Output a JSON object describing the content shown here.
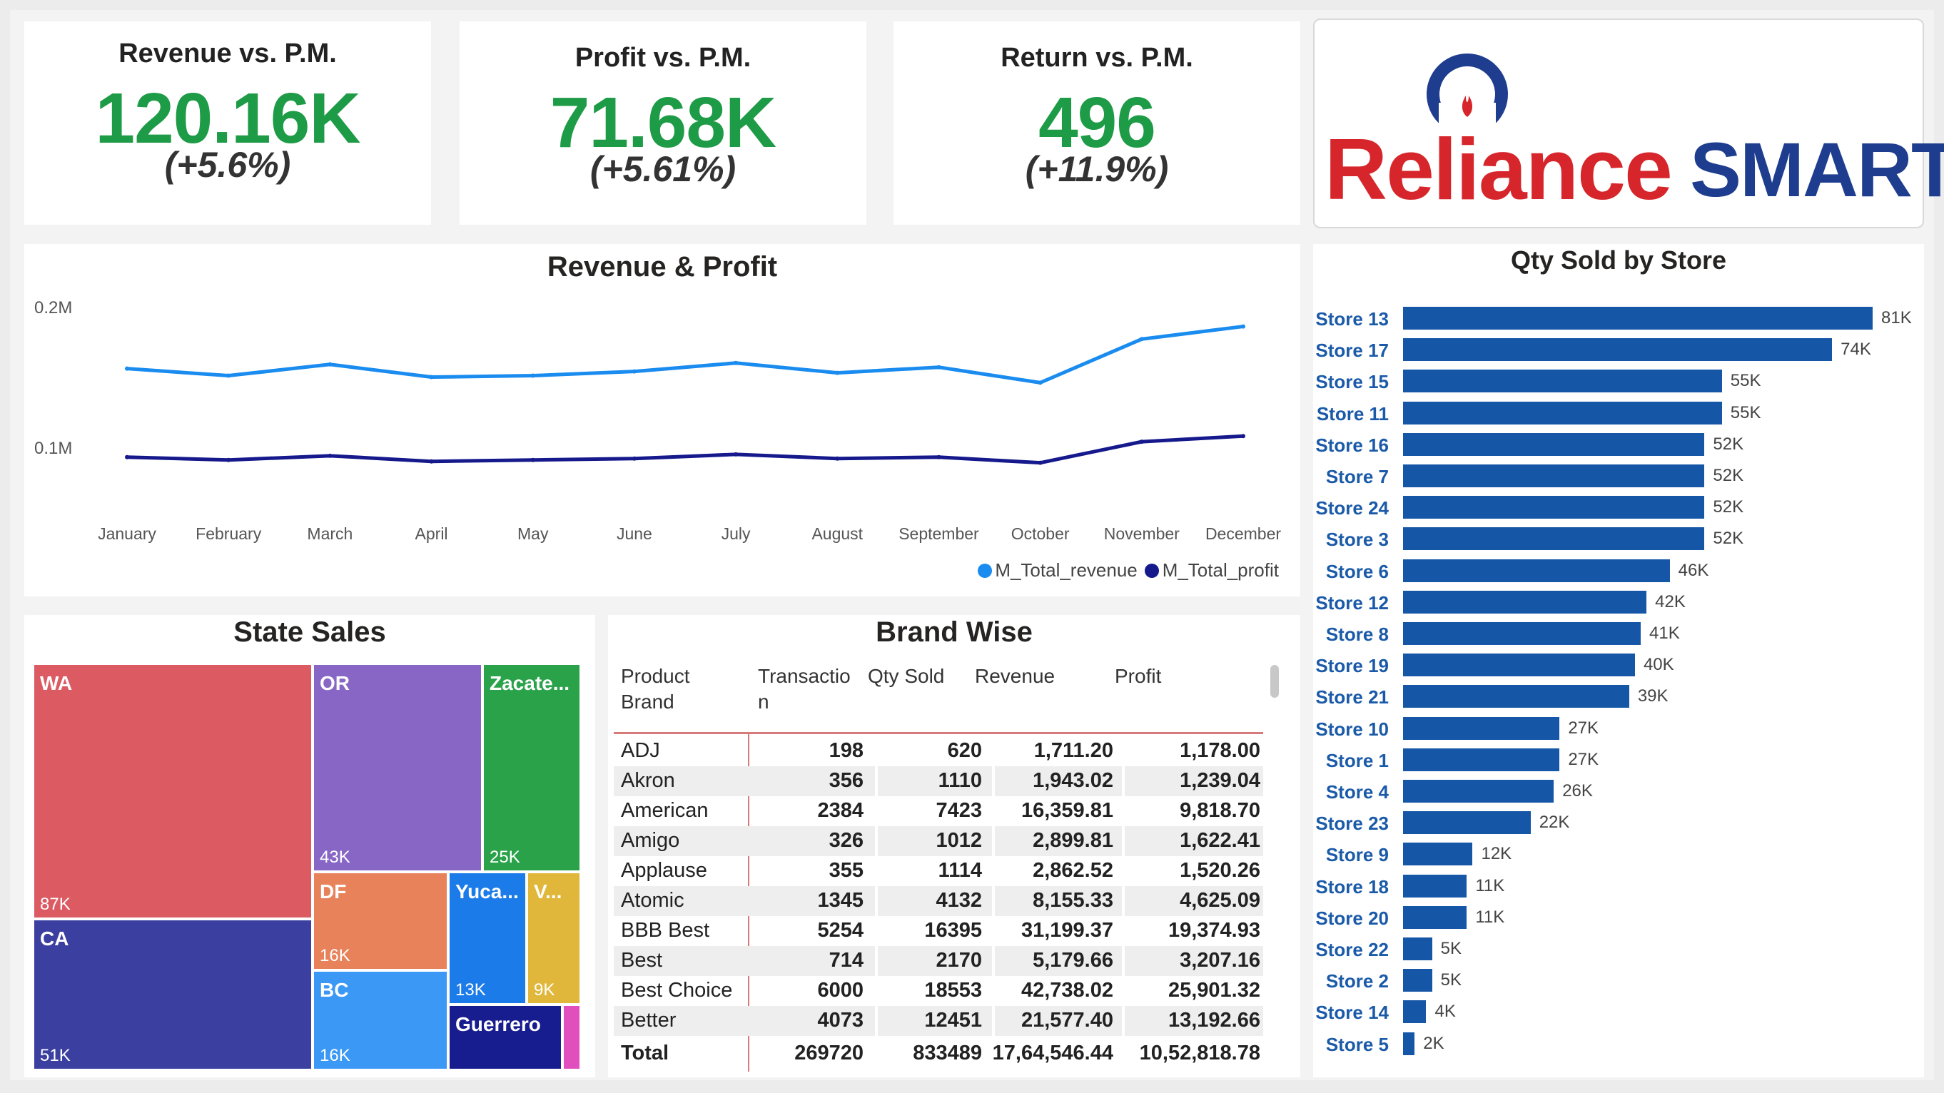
{
  "kpis": [
    {
      "title": "Revenue vs. P.M.",
      "value": "120.16K",
      "delta": "(+5.6%)"
    },
    {
      "title": "Profit vs. P.M.",
      "value": "71.68K",
      "delta": "(+5.61%)"
    },
    {
      "title": "Return vs. P.M.",
      "value": "496",
      "delta": "(+11.9%)"
    }
  ],
  "colors": {
    "kpi_green": "#1e9b46",
    "revenue_line": "#1a8cf0",
    "profit_line": "#15198c",
    "bar": "#1557a6",
    "store_label": "#1a5aa8"
  },
  "logo": {
    "word1": "Reliance",
    "word2": "SMART"
  },
  "revenue_profit": {
    "title": "Revenue & Profit",
    "legend": [
      "M_Total_revenue",
      "M_Total_profit"
    ],
    "y_ticks": [
      "0.2M",
      "0.1M"
    ]
  },
  "state_sales": {
    "title": "State Sales"
  },
  "brand_table": {
    "title": "Brand Wise",
    "headers": [
      "Product Brand",
      "Transaction",
      "Qty Sold",
      "Revenue",
      "Profit"
    ],
    "header_display": [
      [
        "Product",
        "Brand"
      ],
      [
        "Transactio",
        "n"
      ],
      [
        "Qty Sold"
      ],
      [
        "Revenue"
      ],
      [
        "Profit"
      ]
    ],
    "rows": [
      [
        "ADJ",
        "198",
        "620",
        "1,711.20",
        "1,178.00"
      ],
      [
        "Akron",
        "356",
        "1110",
        "1,943.02",
        "1,239.04"
      ],
      [
        "American",
        "2384",
        "7423",
        "16,359.81",
        "9,818.70"
      ],
      [
        "Amigo",
        "326",
        "1012",
        "2,899.81",
        "1,622.41"
      ],
      [
        "Applause",
        "355",
        "1114",
        "2,862.52",
        "1,520.26"
      ],
      [
        "Atomic",
        "1345",
        "4132",
        "8,155.33",
        "4,625.09"
      ],
      [
        "BBB Best",
        "5254",
        "16395",
        "31,199.37",
        "19,374.93"
      ],
      [
        "Best",
        "714",
        "2170",
        "5,179.66",
        "3,207.16"
      ],
      [
        "Best Choice",
        "6000",
        "18553",
        "42,738.02",
        "25,901.32"
      ],
      [
        "Better",
        "4073",
        "12451",
        "21,577.40",
        "13,192.66"
      ]
    ],
    "total": [
      "Total",
      "269720",
      "833489",
      "17,64,546.44",
      "10,52,818.78"
    ]
  },
  "qty_by_store": {
    "title": "Qty Sold by Store"
  },
  "chart_data": [
    {
      "type": "line",
      "title": "Revenue & Profit",
      "x": [
        "January",
        "February",
        "March",
        "April",
        "May",
        "June",
        "July",
        "August",
        "September",
        "October",
        "November",
        "December"
      ],
      "ylim": [
        0,
        0.2
      ],
      "y_unit": "M",
      "series": [
        {
          "name": "M_Total_revenue",
          "values": [
            0.156,
            0.151,
            0.159,
            0.15,
            0.151,
            0.154,
            0.16,
            0.153,
            0.157,
            0.146,
            0.177,
            0.186
          ]
        },
        {
          "name": "M_Total_profit",
          "values": [
            0.093,
            0.091,
            0.094,
            0.09,
            0.091,
            0.092,
            0.095,
            0.092,
            0.093,
            0.089,
            0.104,
            0.108
          ]
        }
      ],
      "legend_position": "bottom-right",
      "grid": false
    },
    {
      "type": "treemap",
      "title": "State Sales",
      "items": [
        {
          "label": "WA",
          "value": "87K",
          "color": "#dc5b62"
        },
        {
          "label": "CA",
          "value": "51K",
          "color": "#3a3fa0"
        },
        {
          "label": "OR",
          "value": "43K",
          "color": "#8766c6"
        },
        {
          "label": "Zacate...",
          "value": "25K",
          "color": "#2aa24a"
        },
        {
          "label": "DF",
          "value": "16K",
          "color": "#e8825a"
        },
        {
          "label": "BC",
          "value": "16K",
          "color": "#3b98f5"
        },
        {
          "label": "Yuca...",
          "value": "13K",
          "color": "#1b7be8"
        },
        {
          "label": "V...",
          "value": "9K",
          "color": "#e0b73a"
        },
        {
          "label": "Guerrero",
          "value": "",
          "color": "#171d8e"
        },
        {
          "label": "",
          "value": "",
          "color": "#e04fbd"
        }
      ]
    },
    {
      "type": "bar",
      "orientation": "horizontal",
      "title": "Qty Sold by Store",
      "categories": [
        "Store 13",
        "Store 17",
        "Store 15",
        "Store 11",
        "Store 16",
        "Store 7",
        "Store 24",
        "Store 3",
        "Store 6",
        "Store 12",
        "Store 8",
        "Store 19",
        "Store 21",
        "Store 10",
        "Store 1",
        "Store 4",
        "Store 23",
        "Store 9",
        "Store 18",
        "Store 20",
        "Store 22",
        "Store 2",
        "Store 14",
        "Store 5"
      ],
      "values": [
        81,
        74,
        55,
        55,
        52,
        52,
        52,
        52,
        46,
        42,
        41,
        40,
        39,
        27,
        27,
        26,
        22,
        12,
        11,
        11,
        5,
        5,
        4,
        2
      ],
      "value_labels": [
        "81K",
        "74K",
        "55K",
        "55K",
        "52K",
        "52K",
        "52K",
        "52K",
        "46K",
        "42K",
        "41K",
        "40K",
        "39K",
        "27K",
        "27K",
        "26K",
        "22K",
        "12K",
        "11K",
        "11K",
        "5K",
        "5K",
        "4K",
        "2K"
      ],
      "unit": "K"
    }
  ]
}
